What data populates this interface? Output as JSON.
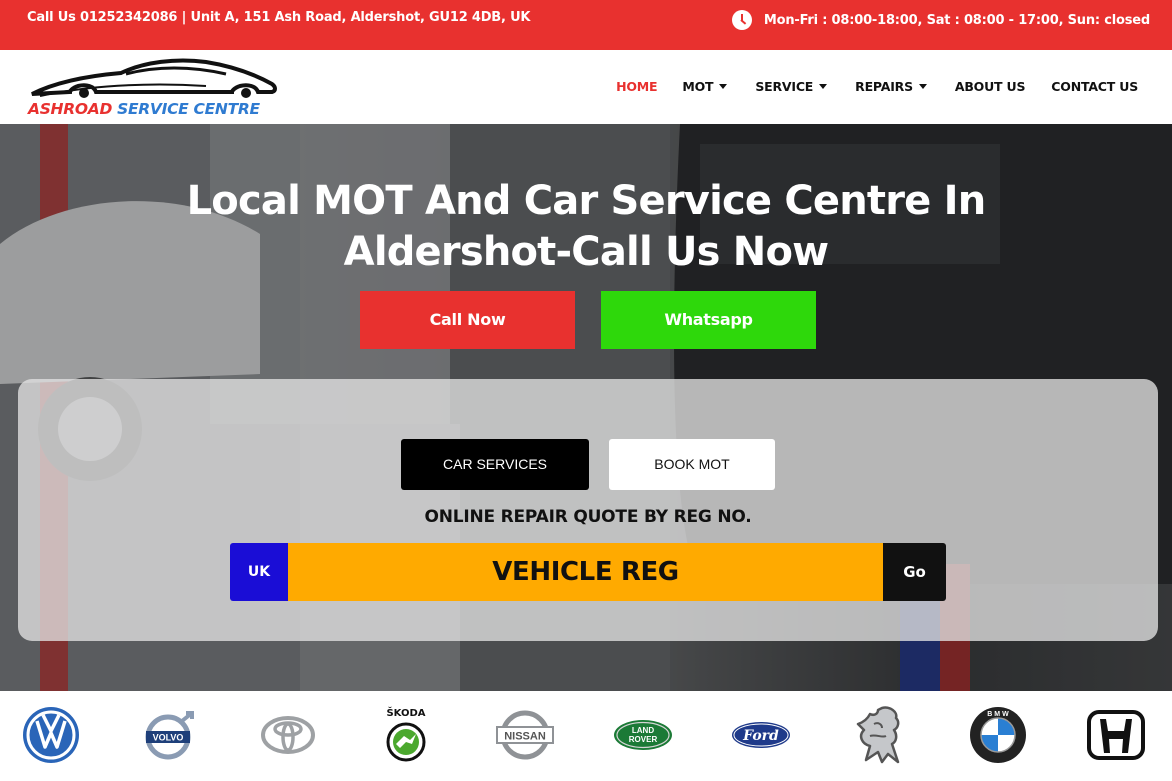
{
  "topbar": {
    "contact": "Call Us 01252342086 | Unit A, 151 Ash Road, Aldershot, GU12 4DB, UK",
    "hours": "Mon-Fri : 08:00-18:00, Sat : 08:00 - 17:00, Sun: closed",
    "hours_icon": "clock-icon"
  },
  "logo": {
    "word1": "ASHROAD",
    "word2": "SERVICE CENTRE"
  },
  "nav": [
    {
      "label": "HOME",
      "active": true,
      "dropdown": false
    },
    {
      "label": "MOT",
      "active": false,
      "dropdown": true
    },
    {
      "label": "SERVICE",
      "active": false,
      "dropdown": true
    },
    {
      "label": "REPAIRS",
      "active": false,
      "dropdown": true
    },
    {
      "label": "ABOUT US",
      "active": false,
      "dropdown": false
    },
    {
      "label": "CONTACT US",
      "active": false,
      "dropdown": false
    }
  ],
  "hero": {
    "title_line1": "Local MOT And Car Service Centre In",
    "title_line2": "Aldershot-Call Us Now",
    "call_button": "Call Now",
    "whatsapp_button": "Whatsapp"
  },
  "quote": {
    "tab_car_services": "CAR SERVICES",
    "tab_book_mot": "BOOK MOT",
    "label": "ONLINE REPAIR QUOTE BY REG NO.",
    "country": "UK",
    "reg_placeholder": "VEHICLE REG",
    "go_button": "Go"
  },
  "brands": {
    "skoda_text": "ŠKODA",
    "land_rover_line1": "LAND",
    "land_rover_line2": "ROVER",
    "volvo_text": "VOLVO",
    "nissan_text": "NISSAN",
    "ford_text": "Ford",
    "bmw_text": "B M W"
  },
  "colors": {
    "brand_red": "#e8312f",
    "whatsapp_green": "#2ed80b",
    "reg_orange": "#ffaa00",
    "uk_blue": "#1a0dd6"
  }
}
